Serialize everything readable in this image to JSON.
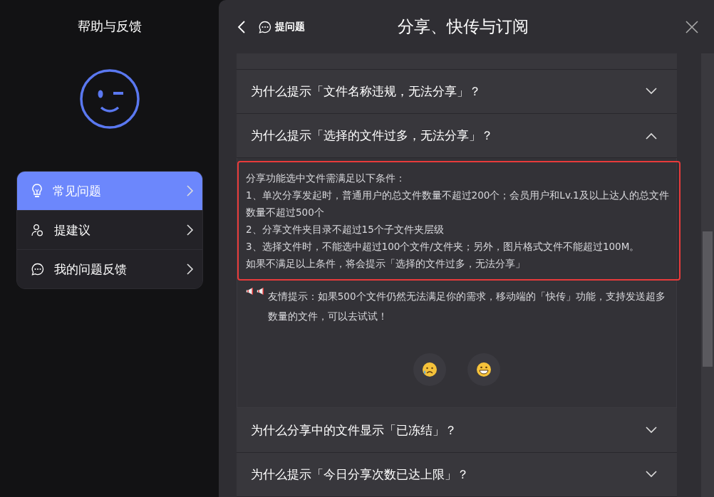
{
  "sidebar": {
    "title": "帮助与反馈",
    "menu": [
      {
        "label": "常见问题",
        "selected": true
      },
      {
        "label": "提建议",
        "selected": false
      },
      {
        "label": "我的问题反馈",
        "selected": false
      }
    ]
  },
  "header": {
    "ask_button": "提问题",
    "title": "分享、快传与订阅"
  },
  "faq": [
    {
      "question": "为什么提示「文件名称违规，无法分享」？",
      "expanded": false
    },
    {
      "question": "为什么提示「选择的文件过多，无法分享」？",
      "expanded": true,
      "answer": [
        "分享功能选中文件需满足以下条件：",
        "1、单次分享发起时，普通用户的总文件数量不超过200个；会员用户和Lv.1及以上达人的总文件数量不超过500个",
        "2、分享文件夹目录不超过15个子文件夹层级",
        "3、选择文件时，不能选中超过100个文件/文件夹；另外，图片格式文件不能超过100M。",
        "如果不满足以上条件，将会提示「选择的文件过多，无法分享」"
      ],
      "tip": "友情提示：如果500个文件仍然无法满足你的需求，移动端的「快传」功能，支持发送超多数量的文件，可以去试试！"
    },
    {
      "question": "为什么分享中的文件显示「已冻结」？",
      "expanded": false
    },
    {
      "question": "为什么提示「今日分享次数已达上限」？",
      "expanded": false
    }
  ]
}
